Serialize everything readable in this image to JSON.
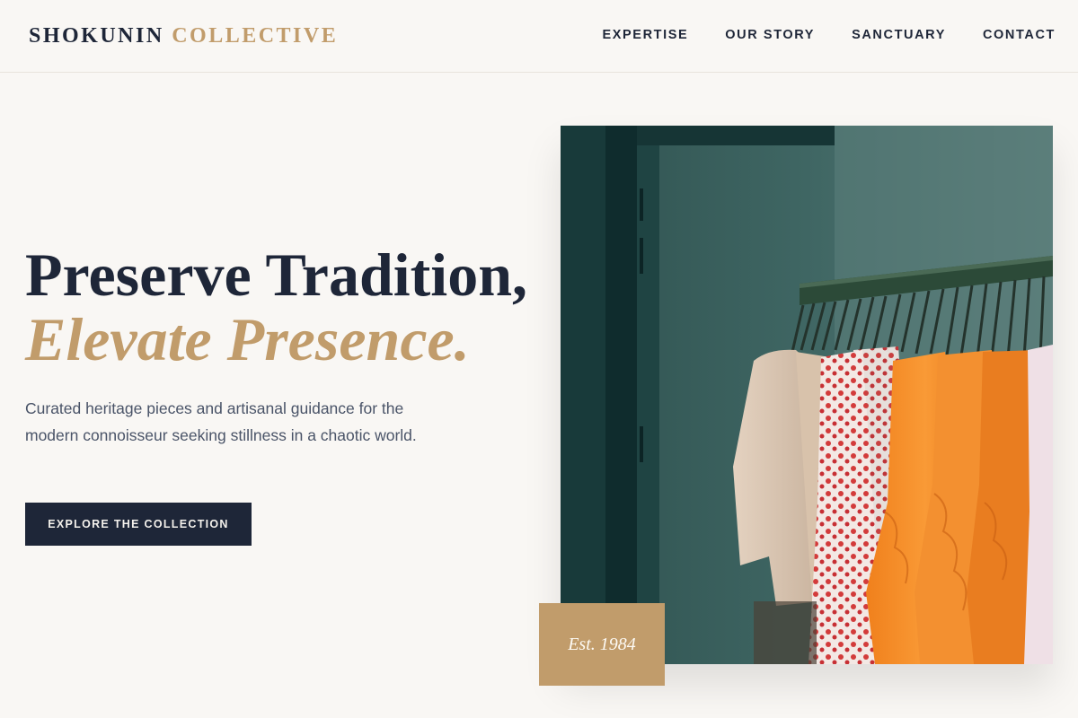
{
  "brand": {
    "name_part1": "SHOKUNIN",
    "name_part2": "COLLECTIVE"
  },
  "nav": {
    "items": [
      "EXPERTISE",
      "OUR STORY",
      "SANCTUARY",
      "CONTACT"
    ]
  },
  "hero": {
    "headline_line1": "Preserve Tradition,",
    "headline_line2": "Elevate Presence.",
    "description": "Curated heritage pieces and artisanal guidance for the modern connoisseur seeking stillness in a chaotic world.",
    "cta_label": "EXPLORE THE COLLECTION",
    "badge": "Est. 1984",
    "image_icon": "clothing-rack-photo"
  },
  "colors": {
    "navy": "#1e2638",
    "gold": "#c19c6b",
    "background": "#f9f7f4",
    "muted_text": "#4a5468"
  }
}
